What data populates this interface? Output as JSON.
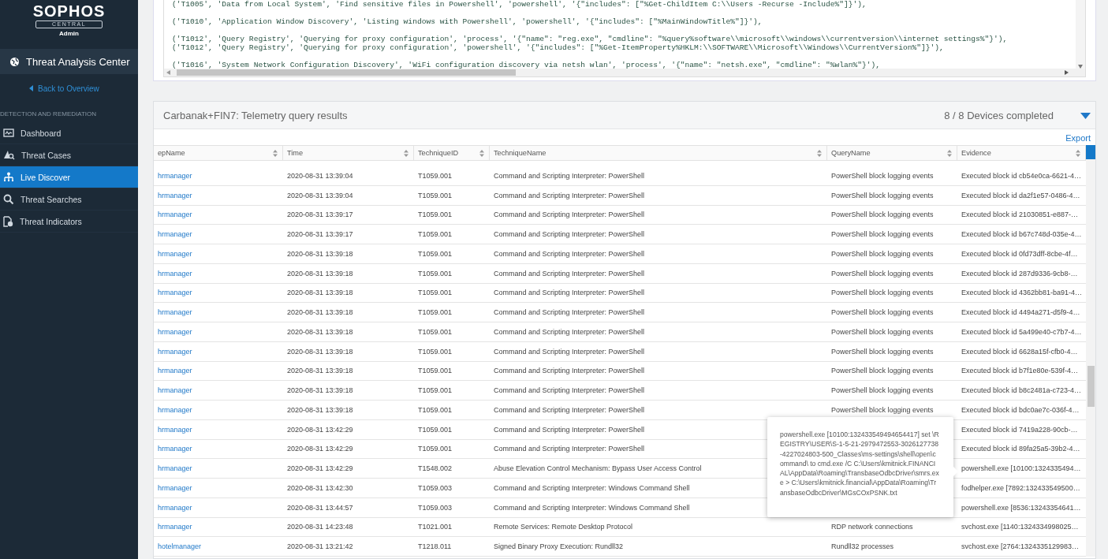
{
  "sidebar": {
    "brand": "SOPHOS",
    "brand_sub": "CENTRAL",
    "role": "Admin",
    "app_title": "Threat Analysis Center",
    "back_link": "Back to Overview",
    "section": "DETECTION AND REMEDIATION",
    "items": [
      {
        "label": "Dashboard",
        "kind": "dashboard",
        "selected": false
      },
      {
        "label": "Threat Cases",
        "kind": "cases",
        "selected": false
      },
      {
        "label": "Live Discover",
        "kind": "network",
        "selected": true
      },
      {
        "label": "Threat Searches",
        "kind": "search",
        "selected": false
      },
      {
        "label": "Threat Indicators",
        "kind": "indicator",
        "selected": false
      }
    ]
  },
  "code_editor": {
    "blocks": [
      [
        "('T1005', 'Data from Local System', 'Find sensitive files in Powershell', 'powershell', '{\"includes\": [\"%Get-ChildItem C:\\\\Users -Recurse -Include%\"]}'),"
      ],
      [
        "('T1010', 'Application Window Discovery', 'Listing windows with Powershell', 'powershell', '{\"includes\": [\"%MainWindowTitle%\"]}'),"
      ],
      [
        "('T1012', 'Query Registry', 'Querying for proxy configuration', 'process', '{\"name\": \"reg.exe\", \"cmdline\": \"%query%software\\\\microsoft\\\\windows\\\\currentversion\\\\internet settings%\"}'),",
        "('T1012', 'Query Registry', 'Querying for proxy configuration', 'powershell', '{\"includes\": [\"%Get-ItemProperty%HKLM:\\\\SOFTWARE\\\\Microsoft\\\\Windows\\\\CurrentVersion%\"]}'),"
      ],
      [
        "('T1016', 'System Network Configuration Discovery', 'WiFi configuration discovery via netsh wlan', 'process', '{\"name\": \"netsh.exe\", \"cmdline\": \"%wlan%\"}'),"
      ]
    ]
  },
  "results": {
    "title": "Carbanak+FIN7: Telemetry query results",
    "status": "8 / 8 Devices completed",
    "expanded": true,
    "export": "Export",
    "columns": [
      "epName",
      "Time",
      "TechniqueID",
      "TechniqueName",
      "QueryName",
      "Evidence"
    ],
    "rows": [
      {
        "ep_name": "hrmanager",
        "time": "2020-08-31 13:39:04",
        "technique_id": "T1059.001",
        "technique_name": "Command and Scripting Interpreter: PowerShell",
        "query_name": "PowerShell block logging events",
        "evidence": "Executed block id cb54e0ca-6621-4…"
      },
      {
        "ep_name": "hrmanager",
        "time": "2020-08-31 13:39:04",
        "technique_id": "T1059.001",
        "technique_name": "Command and Scripting Interpreter: PowerShell",
        "query_name": "PowerShell block logging events",
        "evidence": "Executed block id da2f1e57-0486-4…"
      },
      {
        "ep_name": "hrmanager",
        "time": "2020-08-31 13:39:17",
        "technique_id": "T1059.001",
        "technique_name": "Command and Scripting Interpreter: PowerShell",
        "query_name": "PowerShell block logging events",
        "evidence": "Executed block id 21030851-e887-…"
      },
      {
        "ep_name": "hrmanager",
        "time": "2020-08-31 13:39:17",
        "technique_id": "T1059.001",
        "technique_name": "Command and Scripting Interpreter: PowerShell",
        "query_name": "PowerShell block logging events",
        "evidence": "Executed block id b67c748d-035e-4…"
      },
      {
        "ep_name": "hrmanager",
        "time": "2020-08-31 13:39:18",
        "technique_id": "T1059.001",
        "technique_name": "Command and Scripting Interpreter: PowerShell",
        "query_name": "PowerShell block logging events",
        "evidence": "Executed block id 0fd73dff-8cbe-4f…"
      },
      {
        "ep_name": "hrmanager",
        "time": "2020-08-31 13:39:18",
        "technique_id": "T1059.001",
        "technique_name": "Command and Scripting Interpreter: PowerShell",
        "query_name": "PowerShell block logging events",
        "evidence": "Executed block id 287d9336-9cb8-…"
      },
      {
        "ep_name": "hrmanager",
        "time": "2020-08-31 13:39:18",
        "technique_id": "T1059.001",
        "technique_name": "Command and Scripting Interpreter: PowerShell",
        "query_name": "PowerShell block logging events",
        "evidence": "Executed block id 4362bb81-ba91-4…"
      },
      {
        "ep_name": "hrmanager",
        "time": "2020-08-31 13:39:18",
        "technique_id": "T1059.001",
        "technique_name": "Command and Scripting Interpreter: PowerShell",
        "query_name": "PowerShell block logging events",
        "evidence": "Executed block id 4494a271-d5f9-4…"
      },
      {
        "ep_name": "hrmanager",
        "time": "2020-08-31 13:39:18",
        "technique_id": "T1059.001",
        "technique_name": "Command and Scripting Interpreter: PowerShell",
        "query_name": "PowerShell block logging events",
        "evidence": "Executed block id 5a499e40-c7b7-4…"
      },
      {
        "ep_name": "hrmanager",
        "time": "2020-08-31 13:39:18",
        "technique_id": "T1059.001",
        "technique_name": "Command and Scripting Interpreter: PowerShell",
        "query_name": "PowerShell block logging events",
        "evidence": "Executed block id 6628a15f-cfb0-4…"
      },
      {
        "ep_name": "hrmanager",
        "time": "2020-08-31 13:39:18",
        "technique_id": "T1059.001",
        "technique_name": "Command and Scripting Interpreter: PowerShell",
        "query_name": "PowerShell block logging events",
        "evidence": "Executed block id b7f1e80e-539f-4…"
      },
      {
        "ep_name": "hrmanager",
        "time": "2020-08-31 13:39:18",
        "technique_id": "T1059.001",
        "technique_name": "Command and Scripting Interpreter: PowerShell",
        "query_name": "PowerShell block logging events",
        "evidence": "Executed block id b8c2481a-c723-4…"
      },
      {
        "ep_name": "hrmanager",
        "time": "2020-08-31 13:39:18",
        "technique_id": "T1059.001",
        "technique_name": "Command and Scripting Interpreter: PowerShell",
        "query_name": "PowerShell block logging events",
        "evidence": "Executed block id bdc0ae7c-036f-4…"
      },
      {
        "ep_name": "hrmanager",
        "time": "2020-08-31 13:42:29",
        "technique_id": "T1059.001",
        "technique_name": "Command and Scripting Interpreter: PowerShell",
        "evidence": "Executed block id 7419a228-90cb-…"
      },
      {
        "ep_name": "hrmanager",
        "time": "2020-08-31 13:42:29",
        "technique_id": "T1059.001",
        "technique_name": "Command and Scripting Interpreter: PowerShell",
        "evidence": "Executed block id 89fa25a5-39b2-4…"
      },
      {
        "ep_name": "hrmanager",
        "time": "2020-08-31 13:42:29",
        "technique_id": "T1548.002",
        "technique_name": "Abuse Elevation Control Mechanism: Bypass User Access Control",
        "evidence": "powershell.exe [10100:1324335494…"
      },
      {
        "ep_name": "hrmanager",
        "time": "2020-08-31 13:42:30",
        "technique_id": "T1059.003",
        "technique_name": "Command and Scripting Interpreter: Windows Command Shell",
        "evidence": "fodhelper.exe [7892:132433549500…"
      },
      {
        "ep_name": "hrmanager",
        "time": "2020-08-31 13:44:57",
        "technique_id": "T1059.003",
        "technique_name": "Command and Scripting Interpreter: Windows Command Shell",
        "evidence": "powershell.exe [8536:13243354641…"
      },
      {
        "ep_name": "hrmanager",
        "time": "2020-08-31 14:23:48",
        "technique_id": "T1021.001",
        "technique_name": "Remote Services: Remote Desktop Protocol",
        "query_name": "RDP network connections",
        "evidence": "svchost.exe [1140:1324334998025…"
      },
      {
        "ep_name": "hotelmanager",
        "time": "2020-08-31 13:21:42",
        "technique_id": "T1218.011",
        "technique_name": "Signed Binary Proxy Execution: Rundll32",
        "query_name": "Rundll32 processes",
        "evidence": "svchost.exe [2764:1324335129983…"
      }
    ],
    "tooltip": "powershell.exe [10100:132433549494654417] set \\REGISTRY\\USER\\S-1-5-21-2979472553-3026127738-4227024803-500_Classes\\ms-settings\\shell\\open\\command\\ to cmd.exe /C C:\\Users\\kmitnick.FINANCIAL\\AppData\\Roaming\\TransbaseOdbcDriver\\smrs.exe > C:\\Users\\kmitnick.financial\\AppData\\Roaming\\TransbaseOdbcDriver\\MGsCOxPSNK.txt"
  }
}
